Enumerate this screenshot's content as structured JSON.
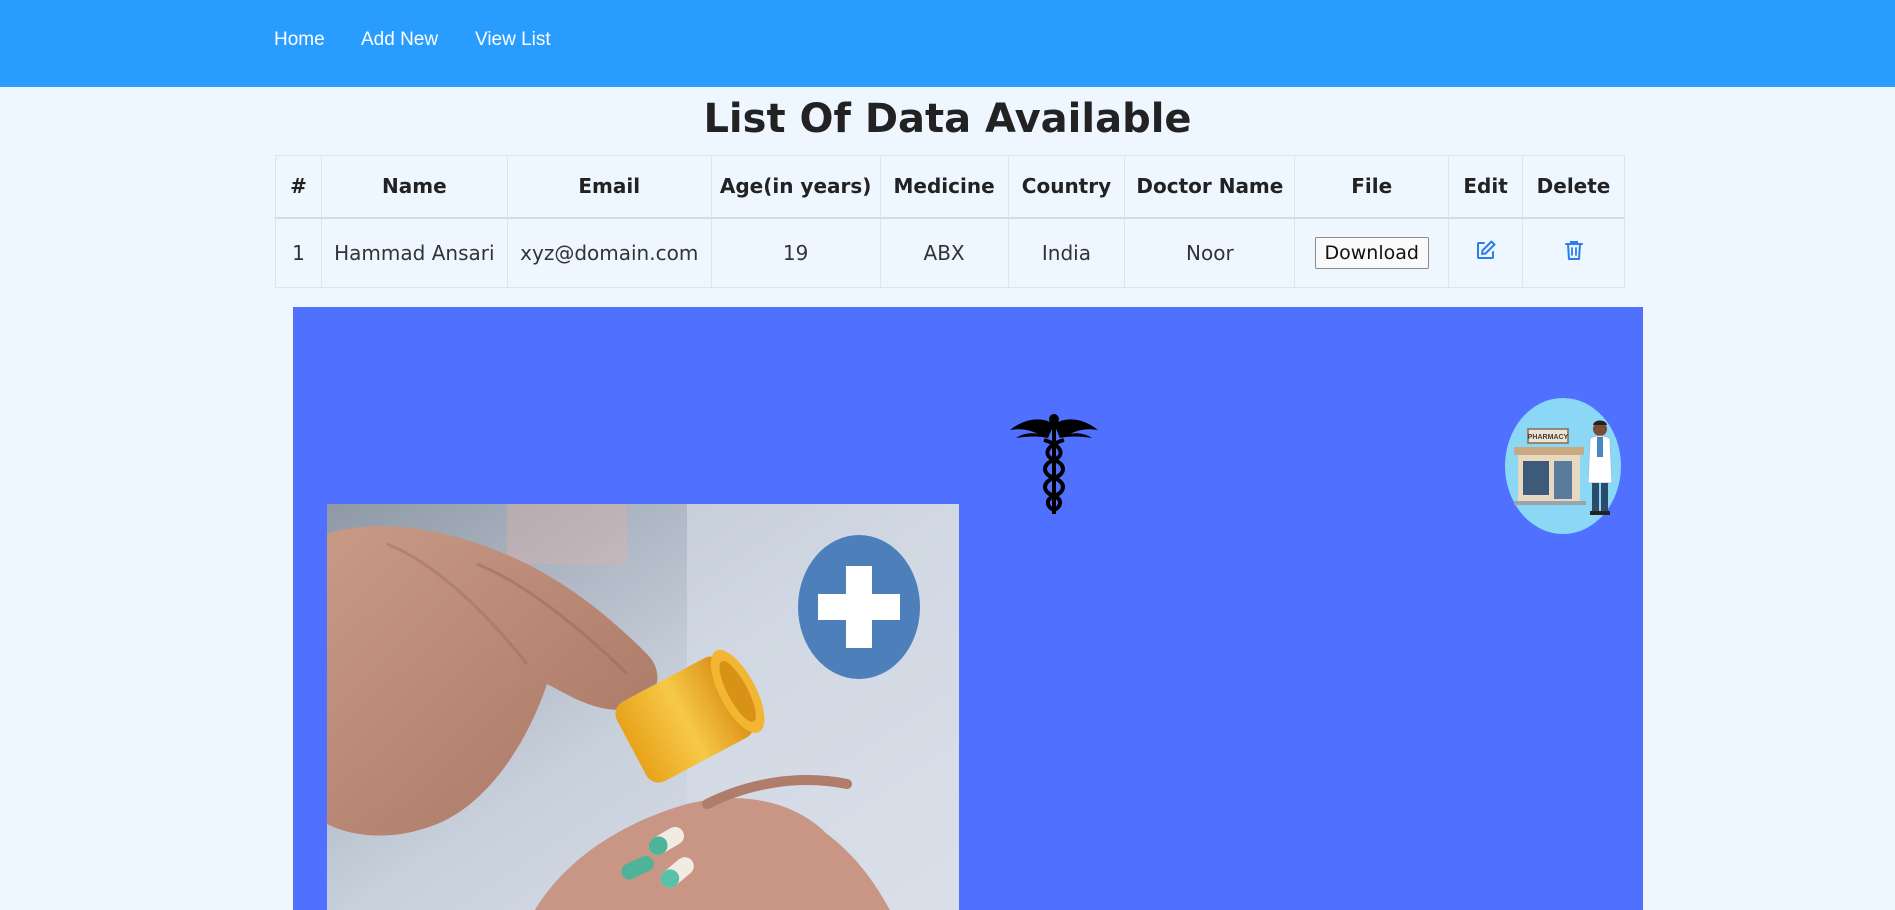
{
  "nav": {
    "links": [
      {
        "label": "Home"
      },
      {
        "label": "Add New"
      },
      {
        "label": "View List"
      }
    ]
  },
  "page": {
    "title": "List Of Data Available"
  },
  "table": {
    "headers": [
      "#",
      "Name",
      "Email",
      "Age(in years)",
      "Medicine",
      "Country",
      "Doctor Name",
      "File",
      "Edit",
      "Delete"
    ],
    "rows": [
      {
        "index": "1",
        "name": "Hammad Ansari",
        "email": "xyz@domain.com",
        "age": "19",
        "medicine": "ABX",
        "country": "India",
        "doctor": "Noor",
        "file_button": "Download",
        "edit_icon": "edit-icon",
        "delete_icon": "trash-icon"
      }
    ]
  },
  "banner": {
    "caduceus_icon": "caduceus-icon",
    "pharmacy_sign": "PHARMACY",
    "colors": {
      "panel": "#5070ff",
      "navbar": "#299cff",
      "icon_blue": "#2b7ee8",
      "cross_badge": "#4d80bb",
      "pharmacy_badge": "#8ad8f6"
    }
  }
}
